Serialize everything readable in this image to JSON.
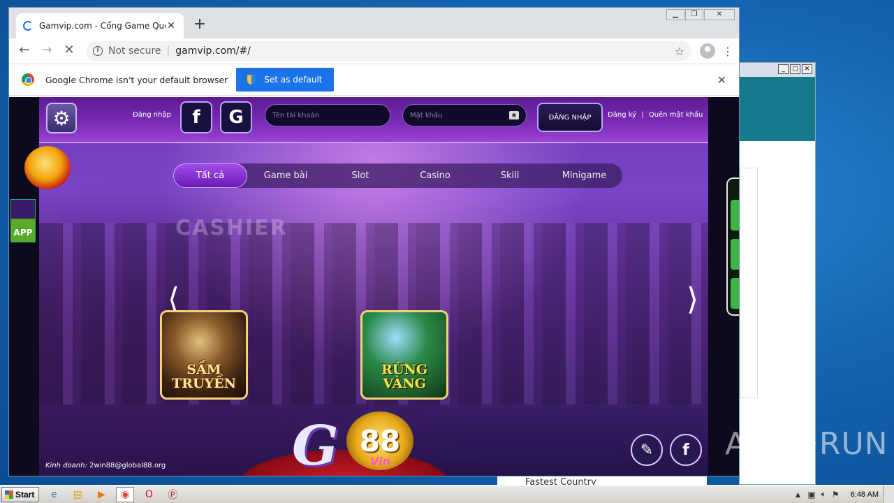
{
  "browser": {
    "tab_title": "Gamvip.com - Cổng Game Quốc Tế",
    "new_tab": "+",
    "omnibox": {
      "security": "Not secure",
      "url": "gamvip.com/#/"
    },
    "infobar": {
      "message": "Google Chrome isn't your default browser",
      "button": "Set as default"
    }
  },
  "game": {
    "login_label": "Đăng nhập",
    "facebook_glyph": "f",
    "google_glyph": "G",
    "username_placeholder": "Tên tài khoản",
    "password_placeholder": "Mật khẩu",
    "login_button": "ĐĂNG NHẬP",
    "register_link": "Đăng ký",
    "link_separator": "|",
    "forgot_link": "Quên mật khẩu",
    "app_label": "APP",
    "cashier_sign": "CASHIER",
    "categories": [
      "Tất cả",
      "Game bài",
      "Slot",
      "Casino",
      "Skill",
      "Minigame"
    ],
    "active_category": "Tất cả",
    "prev_arrow": "⟨",
    "next_arrow": "⟩",
    "games": [
      {
        "title_line1": "SẤM",
        "title_line2": "TRUYỀN"
      },
      {
        "title_line1": "RỪNG",
        "title_line2": "VÀNG"
      }
    ],
    "logo": {
      "letter": "G",
      "number": "88",
      "suffix": "Vin"
    },
    "contact_label": "Kinh doanh:",
    "contact_email": "2win88@global88.org"
  },
  "watermark": {
    "left": "ANY",
    "right": "RUN"
  },
  "behind_window_text": "Fastest Country",
  "taskbar": {
    "start_label": "Start",
    "clock": "6:48 AM"
  },
  "colors": {
    "accent": "#1a73e8",
    "game_purple": "#7a45c9",
    "active_tab": "#a24ce8",
    "gold": "#f3d27a"
  }
}
